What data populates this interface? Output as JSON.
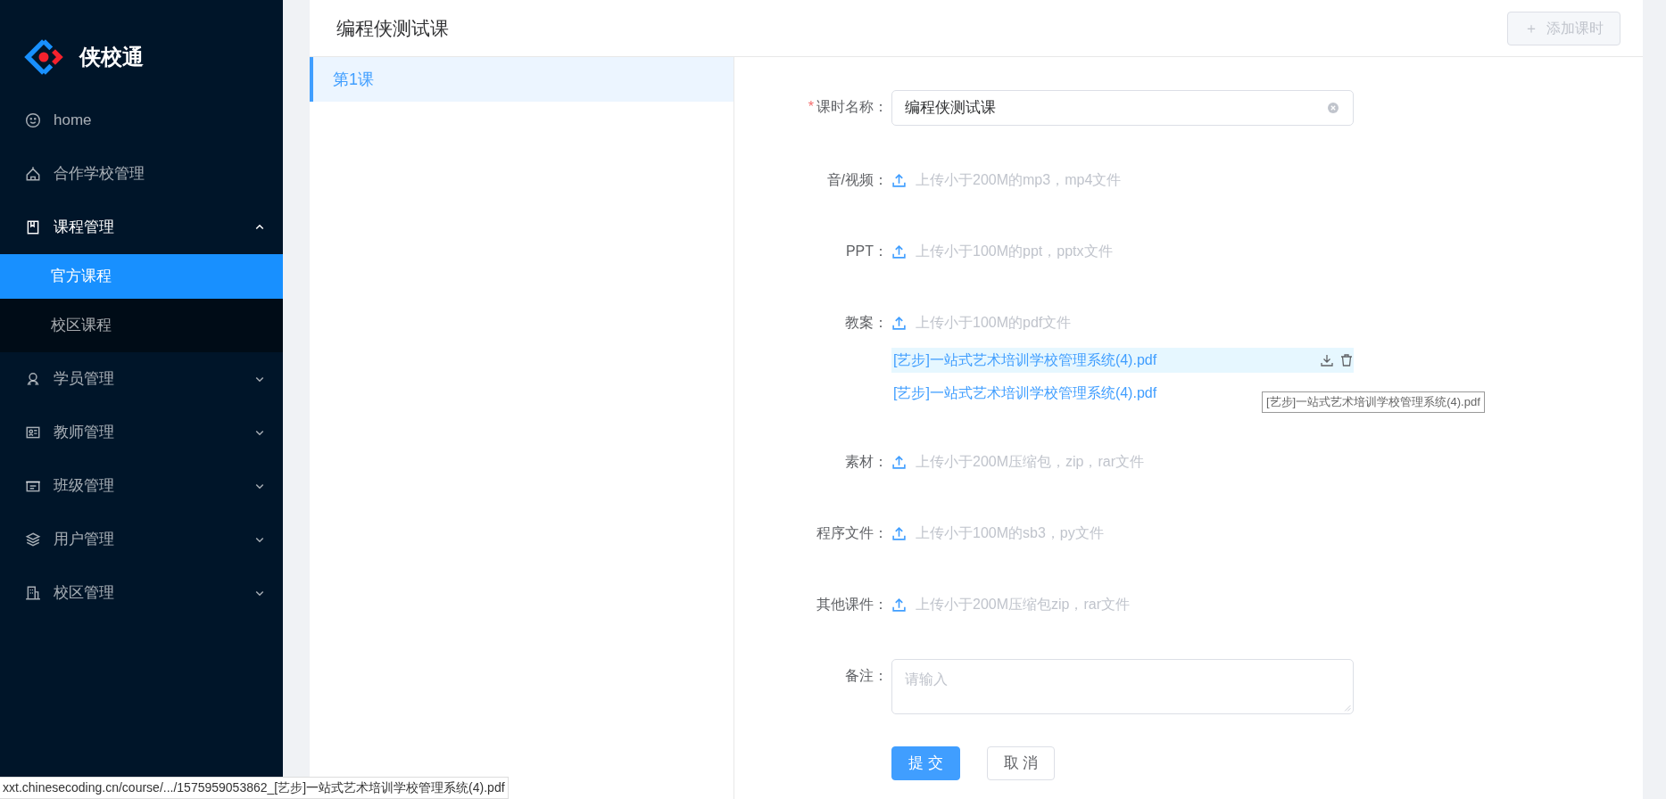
{
  "sidebar": {
    "logo_text": "侠校通",
    "items": [
      {
        "label": "home"
      },
      {
        "label": "合作学校管理"
      },
      {
        "label": "课程管理",
        "expanded": true,
        "children": [
          {
            "label": "官方课程",
            "selected": true
          },
          {
            "label": "校区课程",
            "selected": false
          }
        ]
      },
      {
        "label": "学员管理",
        "expanded": false
      },
      {
        "label": "教师管理",
        "expanded": false
      },
      {
        "label": "班级管理",
        "expanded": false
      },
      {
        "label": "用户管理",
        "expanded": false
      },
      {
        "label": "校区管理",
        "expanded": false
      }
    ]
  },
  "header": {
    "title": "编程侠测试课",
    "add_button": {
      "icon": "＋",
      "label": "添加课时",
      "disabled": true
    }
  },
  "lessons": [
    {
      "label": "第1课",
      "selected": true
    }
  ],
  "form": {
    "fields": [
      {
        "kind": "text",
        "label": "课时名称：",
        "required_mark": "*",
        "value": "编程侠测试课"
      },
      {
        "kind": "upload",
        "label": "音/视频：",
        "hint": "上传小于200M的mp3，mp4文件"
      },
      {
        "kind": "upload",
        "label": "PPT：",
        "hint": "上传小于100M的ppt，pptx文件"
      },
      {
        "kind": "upload",
        "label": "教案：",
        "hint": "上传小于100M的pdf文件",
        "files": [
          {
            "name": "[艺步]一站式艺术培训学校管理系统(4).pdf",
            "hovered": true
          },
          {
            "name": "[艺步]一站式艺术培训学校管理系统(4).pdf",
            "hovered": false,
            "tooltip": "[艺步]一站式艺术培训学校管理系统(4).pdf"
          }
        ]
      },
      {
        "kind": "upload",
        "label": "素材：",
        "hint": "上传小于200M压缩包，zip，rar文件"
      },
      {
        "kind": "upload",
        "label": "程序文件：",
        "hint": "上传小于100M的sb3，py文件"
      },
      {
        "kind": "upload",
        "label": "其他课件：",
        "hint": "上传小于200M压缩包zip，rar文件"
      },
      {
        "kind": "textarea",
        "label": "备注：",
        "placeholder": "请输入"
      }
    ],
    "buttons": [
      {
        "label": "提 交",
        "kind": "primary"
      },
      {
        "label": "取 消",
        "kind": "default"
      }
    ]
  },
  "status_url": "xxt.chinesecoding.cn/course/.../1575959053862_[艺步]一站式艺术培训学校管理系统(4).pdf"
}
